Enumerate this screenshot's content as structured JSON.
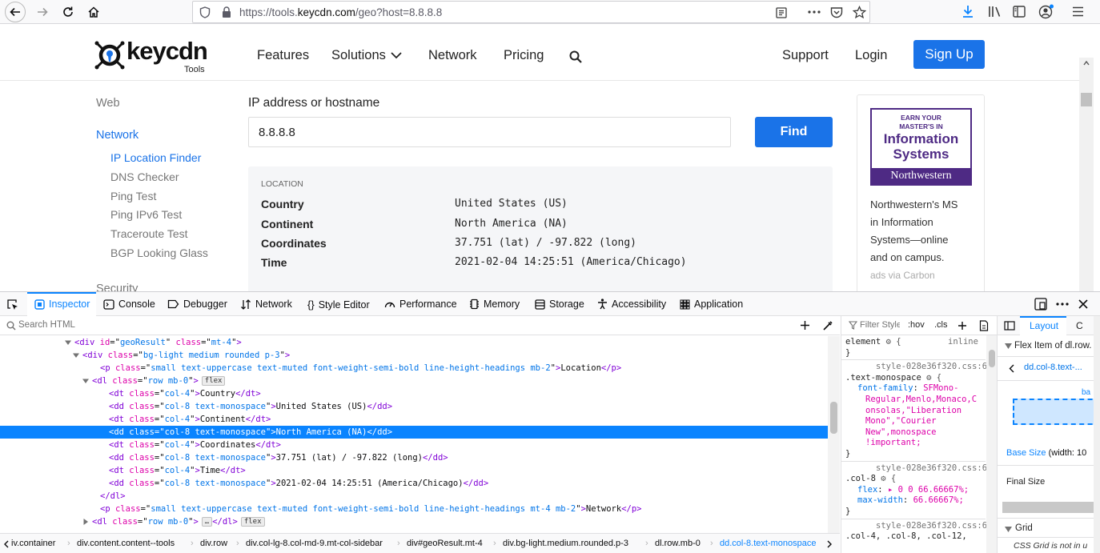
{
  "browser": {
    "url_prefix": "https://tools.",
    "url_domain": "keycdn.com",
    "url_suffix": "/geo?host=8.8.8.8"
  },
  "site": {
    "logo_text": "keycdn",
    "logo_sub": "Tools",
    "nav": [
      "Features",
      "Solutions",
      "Network",
      "Pricing"
    ],
    "support": "Support",
    "login": "Login",
    "signup": "Sign Up"
  },
  "sidebar": {
    "web": "Web",
    "network": "Network",
    "items": [
      "IP Location Finder",
      "DNS Checker",
      "Ping Test",
      "Ping IPv6 Test",
      "Traceroute Test",
      "BGP Looking Glass"
    ],
    "security": "Security"
  },
  "form": {
    "label": "IP address or hostname",
    "value": "8.8.8.8",
    "button": "Find"
  },
  "result": {
    "heading": "LOCATION",
    "rows": [
      {
        "label": "Country",
        "value": "United States (US)"
      },
      {
        "label": "Continent",
        "value": "North America (NA)"
      },
      {
        "label": "Coordinates",
        "value": "37.751 (lat) / -97.822 (long)"
      },
      {
        "label": "Time",
        "value": "2021-02-04 14:25:51 (America/Chicago)"
      }
    ]
  },
  "ad": {
    "logo_lines": [
      "EARN YOUR",
      "MASTER'S IN",
      "Information",
      "Systems",
      "Northwestern"
    ],
    "text": [
      "Northwestern's MS",
      "in Information",
      "Systems—online",
      "and on campus."
    ],
    "via": "ads via Carbon"
  },
  "devtools": {
    "tabs": [
      "Inspector",
      "Console",
      "Debugger",
      "Network",
      "Style Editor",
      "Performance",
      "Memory",
      "Storage",
      "Accessibility",
      "Application"
    ],
    "search_placeholder": "Search HTML",
    "breadcrumbs": [
      "iv.container",
      "div.content.content--tools",
      "div.row",
      "div.col-lg-8.col-md-9.mt-col-sidebar",
      "div#geoResult.mt-4",
      "div.bg-light.medium.rounded.p-3",
      "dl.row.mb-0",
      "dd.col-8.text-monospace"
    ],
    "rules_filter": "Filter Styles",
    "hov": ":hov",
    "cls": ".cls",
    "layout_tab": "Layout",
    "computed_tab": "C",
    "flex_item": "Flex Item of dl.row.",
    "flex_selector": "dd.col-8.text-...",
    "base_size": "Base Size",
    "base_size_val": "(width: 10",
    "final_size": "Final Size",
    "grid": "Grid",
    "grid_note": "CSS Grid is not in u",
    "box_label": "ba"
  },
  "tree": [
    {
      "ind": 84,
      "arrow": "open",
      "tag": "div",
      "attrs": [
        [
          "id",
          "geoResult"
        ],
        [
          "class",
          "mt-4"
        ]
      ],
      "text": "",
      "close": false
    },
    {
      "ind": 94,
      "arrow": "open",
      "tag": "div",
      "attrs": [
        [
          "class",
          "bg-light medium rounded p-3"
        ]
      ],
      "text": "",
      "close": false
    },
    {
      "ind": 116,
      "arrow": "",
      "tag": "p",
      "attrs": [
        [
          "class",
          "small text-uppercase text-muted font-weight-semi-bold line-height-headings mb-2"
        ]
      ],
      "text": "Location",
      "close": true
    },
    {
      "ind": 106,
      "arrow": "open",
      "tag": "dl",
      "attrs": [
        [
          "class",
          "row mb-0"
        ]
      ],
      "text": "",
      "close": false,
      "badge": "flex"
    },
    {
      "ind": 127,
      "arrow": "",
      "tag": "dt",
      "attrs": [
        [
          "class",
          "col-4"
        ]
      ],
      "text": "Country",
      "close": true
    },
    {
      "ind": 127,
      "arrow": "",
      "tag": "dd",
      "attrs": [
        [
          "class",
          "col-8 text-monospace"
        ]
      ],
      "text": "United States (US)",
      "close": true
    },
    {
      "ind": 127,
      "arrow": "",
      "tag": "dt",
      "attrs": [
        [
          "class",
          "col-4"
        ]
      ],
      "text": "Continent",
      "close": true
    },
    {
      "ind": 127,
      "arrow": "",
      "tag": "dd",
      "attrs": [
        [
          "class",
          "col-8 text-monospace"
        ]
      ],
      "text": "North America (NA)",
      "close": true,
      "selected": true
    },
    {
      "ind": 127,
      "arrow": "",
      "tag": "dt",
      "attrs": [
        [
          "class",
          "col-4"
        ]
      ],
      "text": "Coordinates",
      "close": true
    },
    {
      "ind": 127,
      "arrow": "",
      "tag": "dd",
      "attrs": [
        [
          "class",
          "col-8 text-monospace"
        ]
      ],
      "text": "37.751 (lat) / -97.822 (long)",
      "close": true
    },
    {
      "ind": 127,
      "arrow": "",
      "tag": "dt",
      "attrs": [
        [
          "class",
          "col-4"
        ]
      ],
      "text": "Time",
      "close": true
    },
    {
      "ind": 127,
      "arrow": "",
      "tag": "dd",
      "attrs": [
        [
          "class",
          "col-8 text-monospace"
        ]
      ],
      "text": "2021-02-04 14:25:51 (America/Chicago)",
      "close": true
    },
    {
      "ind": 116,
      "arrow": "",
      "tag": "/dl",
      "attrs": [],
      "text": "",
      "close": false
    },
    {
      "ind": 116,
      "arrow": "",
      "tag": "p",
      "attrs": [
        [
          "class",
          "small text-uppercase text-muted font-weight-semi-bold line-height-headings mt-4 mb-2"
        ]
      ],
      "text": "Network",
      "close": true
    },
    {
      "ind": 106,
      "arrow": "closed",
      "tag": "dl",
      "attrs": [
        [
          "class",
          "row mb-0"
        ]
      ],
      "text": "",
      "close": false,
      "collapsed": true,
      "badge": "flex"
    }
  ],
  "rules": [
    {
      "type": "header",
      "sel": "element",
      "extra": "inline"
    },
    {
      "type": "close"
    },
    {
      "type": "src",
      "text": "style-028e36f320.css:6"
    },
    {
      "type": "sel",
      "sel": ".text-monospace"
    },
    {
      "type": "decl",
      "prop": "font-family",
      "val": "SFMono-"
    },
    {
      "type": "cont",
      "val": "Regular,Menlo,Monaco,C"
    },
    {
      "type": "cont",
      "val": "onsolas,\"Liberation"
    },
    {
      "type": "cont",
      "val": "Mono\",\"Courier"
    },
    {
      "type": "cont",
      "val": "New\",monospace"
    },
    {
      "type": "cont",
      "val": "!important;"
    },
    {
      "type": "close"
    },
    {
      "type": "src",
      "text": "style-028e36f320.css:6"
    },
    {
      "type": "sel",
      "sel": ".col-8"
    },
    {
      "type": "decl",
      "prop": "flex",
      "val": "▸ 0 0 66.66667%;"
    },
    {
      "type": "decl",
      "prop": "max-width",
      "val": "66.66667%;"
    },
    {
      "type": "close"
    },
    {
      "type": "src",
      "text": "style-028e36f320.css:6"
    },
    {
      "type": "plain",
      "text": ".col-4, .col-8, .col-12,"
    }
  ]
}
